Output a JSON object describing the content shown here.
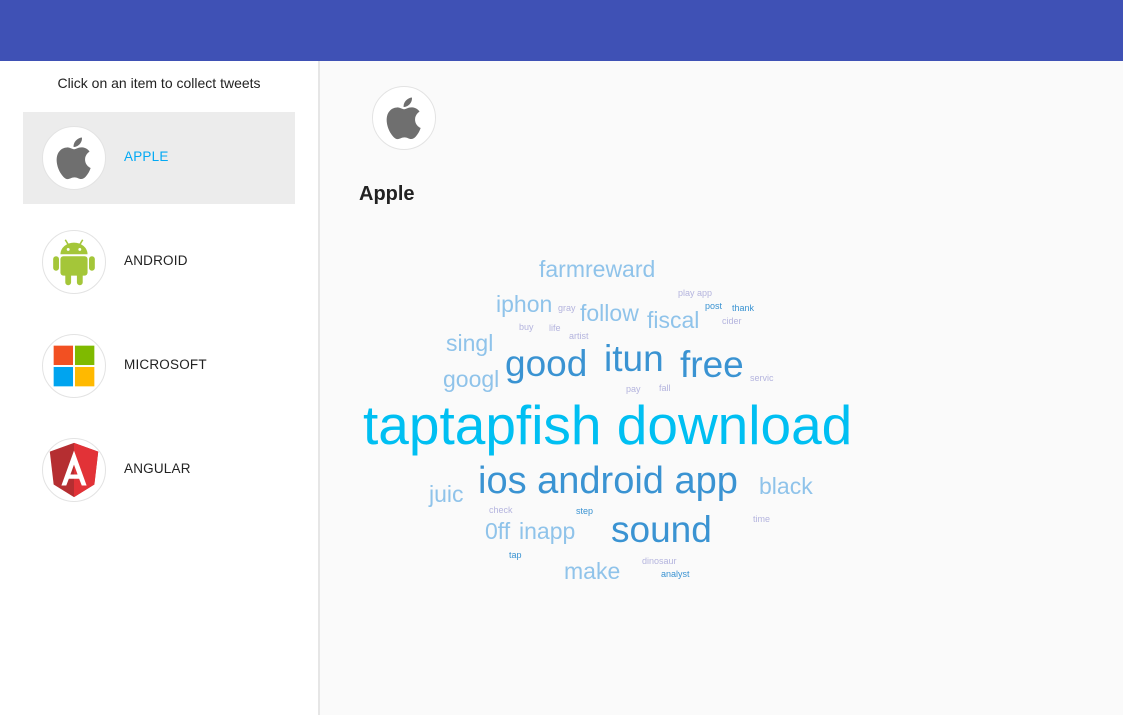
{
  "sidebar": {
    "hint": "Click on an item to collect tweets",
    "items": [
      {
        "label": "APPLE",
        "icon": "apple-logo-icon",
        "selected": true
      },
      {
        "label": "ANDROID",
        "icon": "android-logo-icon",
        "selected": false
      },
      {
        "label": "MICROSOFT",
        "icon": "microsoft-logo-icon",
        "selected": false
      },
      {
        "label": "ANGULAR",
        "icon": "angular-logo-icon",
        "selected": false
      }
    ]
  },
  "main": {
    "title": "Apple",
    "icon": "apple-logo-icon"
  },
  "wordcloud": {
    "words": [
      {
        "text": "taptapfish download"
      },
      {
        "text": "ios android app"
      },
      {
        "text": "good"
      },
      {
        "text": "itun"
      },
      {
        "text": "free"
      },
      {
        "text": "sound"
      },
      {
        "text": "farmreward"
      },
      {
        "text": "iphon"
      },
      {
        "text": "gray"
      },
      {
        "text": "follow"
      },
      {
        "text": "fiscal"
      },
      {
        "text": "play app"
      },
      {
        "text": "post"
      },
      {
        "text": "thank"
      },
      {
        "text": "cider"
      },
      {
        "text": "buy"
      },
      {
        "text": "life"
      },
      {
        "text": "artist"
      },
      {
        "text": "singl"
      },
      {
        "text": "googl"
      },
      {
        "text": "servic"
      },
      {
        "text": "pay"
      },
      {
        "text": "fall"
      },
      {
        "text": "juic"
      },
      {
        "text": "black"
      },
      {
        "text": "check"
      },
      {
        "text": "step"
      },
      {
        "text": "0ff"
      },
      {
        "text": "inapp"
      },
      {
        "text": "time"
      },
      {
        "text": "tap"
      },
      {
        "text": "make"
      },
      {
        "text": "dinosaur"
      },
      {
        "text": "analyst"
      }
    ]
  },
  "colors": {
    "header": "#3f51b5",
    "accent": "#03a9f4"
  }
}
